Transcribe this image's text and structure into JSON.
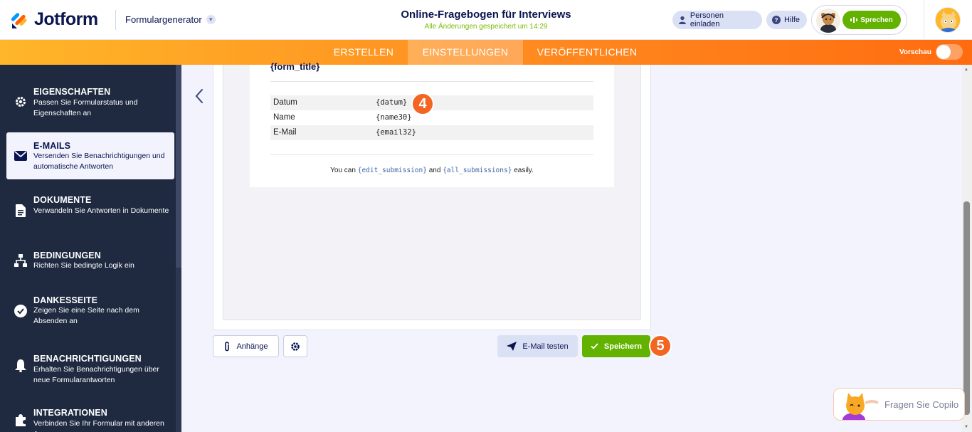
{
  "header": {
    "logo_text": "Jotform",
    "form_builder_label": "Formulargenerator",
    "form_title": "Online-Fragebogen für Interviews",
    "saved_status": "Alle Änderungen gespeichert um 14:29",
    "invite_label": "Personen einladen",
    "help_label": "Hilfe",
    "speak_label": "Sprechen"
  },
  "nav": {
    "tabs": [
      {
        "label": "ERSTELLEN",
        "active": false
      },
      {
        "label": "EINSTELLUNGEN",
        "active": true
      },
      {
        "label": "VERÖFFENTLICHEN",
        "active": false
      }
    ],
    "preview_label": "Vorschau"
  },
  "sidebar": {
    "items": [
      {
        "title": "EIGENSCHAFTEN",
        "desc": "Passen Sie Formularstatus und Eigenschaften an",
        "icon": "gear-icon"
      },
      {
        "title": "E-MAILS",
        "desc": "Versenden Sie Benachrichtigungen und automatische Antworten",
        "icon": "envelope-icon",
        "active": true
      },
      {
        "title": "DOKUMENTE",
        "desc": "Verwandeln Sie Antworten in Dokumente",
        "icon": "document-icon"
      },
      {
        "title": "BEDINGUNGEN",
        "desc": "Richten Sie bedingte Logik ein",
        "icon": "logic-tree-icon"
      },
      {
        "title": "DANKESSEITE",
        "desc": "Zeigen Sie eine Seite nach dem Absenden an",
        "icon": "check-circle-icon"
      },
      {
        "title": "BENACHRICHTIGUNGEN",
        "desc": "Erhalten Sie Benachrichtigungen über neue Formularantworten",
        "icon": "bell-icon"
      },
      {
        "title": "INTEGRATIONEN",
        "desc": "Verbinden Sie Ihr Formular mit anderen Apps",
        "icon": "puzzle-icon"
      }
    ]
  },
  "email_preview": {
    "title": "{form_title}",
    "rows": [
      {
        "label": "Datum",
        "value": "{datum}"
      },
      {
        "label": "Name",
        "value": "{name30}"
      },
      {
        "label": "E-Mail",
        "value": "{email32}"
      }
    ],
    "footer_prefix": "You can",
    "footer_tag1": "{edit_submission}",
    "footer_mid": "and",
    "footer_tag2": "{all_submissions}",
    "footer_suffix": "easily."
  },
  "actions": {
    "attachments_label": "Anhänge",
    "test_email_label": "E-Mail testen",
    "save_label": "Speichern"
  },
  "step_badges": {
    "step4": "4",
    "step5": "5"
  },
  "copilot": {
    "label": "Fragen Sie Copilo"
  },
  "colors": {
    "accent_orange": "#ff6c10",
    "green": "#64b200",
    "sidebar_bg": "#1f2a41",
    "badge": "#f26522"
  }
}
